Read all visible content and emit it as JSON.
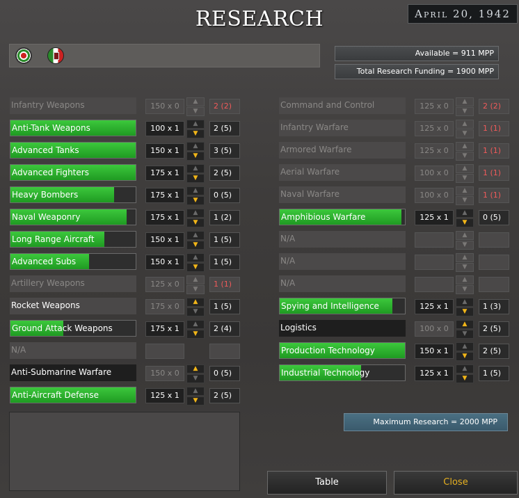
{
  "header": {
    "title": "RESEARCH",
    "date": "April 20, 1942"
  },
  "flags": [
    "roundel-icon",
    "italy-shield-icon"
  ],
  "mpp": {
    "available": "Available = 911 MPP",
    "funding": "Total Research Funding = 1900 MPP"
  },
  "left": [
    {
      "name": "Infantry Weapons",
      "cost": "150 x 0",
      "level": "2 (2)",
      "fill": 0,
      "style": "dim",
      "cost_style": "dim",
      "level_style": "red",
      "up": "faint",
      "down": "faint"
    },
    {
      "name": "Anti-Tank Weapons",
      "cost": "100 x 1",
      "level": "2 (5)",
      "fill": 1.0,
      "style": "green",
      "cost_style": "",
      "level_style": "",
      "up": "off",
      "down": "on"
    },
    {
      "name": "Advanced Tanks",
      "cost": "150 x 1",
      "level": "3 (5)",
      "fill": 1.0,
      "style": "green",
      "cost_style": "",
      "level_style": "",
      "up": "off",
      "down": "on"
    },
    {
      "name": "Advanced Fighters",
      "cost": "175 x 1",
      "level": "2 (5)",
      "fill": 1.0,
      "style": "green",
      "cost_style": "",
      "level_style": "",
      "up": "off",
      "down": "on"
    },
    {
      "name": "Heavy Bombers",
      "cost": "175 x 1",
      "level": "0 (5)",
      "fill": 0.83,
      "style": "green",
      "cost_style": "",
      "level_style": "",
      "up": "off",
      "down": "on"
    },
    {
      "name": "Naval Weaponry",
      "cost": "175 x 1",
      "level": "1 (2)",
      "fill": 0.93,
      "style": "green",
      "cost_style": "",
      "level_style": "",
      "up": "off",
      "down": "on"
    },
    {
      "name": "Long Range Aircraft",
      "cost": "150 x 1",
      "level": "1 (5)",
      "fill": 0.75,
      "style": "green",
      "cost_style": "",
      "level_style": "",
      "up": "off",
      "down": "on"
    },
    {
      "name": "Advanced Subs",
      "cost": "150 x 1",
      "level": "1 (5)",
      "fill": 0.63,
      "style": "green",
      "cost_style": "",
      "level_style": "",
      "up": "off",
      "down": "on"
    },
    {
      "name": "Artillery Weapons",
      "cost": "125 x 0",
      "level": "1 (1)",
      "fill": 0,
      "style": "dim",
      "cost_style": "dim",
      "level_style": "red",
      "up": "faint",
      "down": "faint"
    },
    {
      "name": "Rocket Weapons",
      "cost": "175 x 0",
      "level": "1 (5)",
      "fill": 0,
      "style": "plain",
      "cost_style": "dim",
      "level_style": "",
      "up": "on",
      "down": "off"
    },
    {
      "name": "Ground Attack Weapons",
      "cost": "175 x 1",
      "level": "2 (4)",
      "fill": 0.42,
      "style": "green",
      "cost_style": "",
      "level_style": "",
      "up": "off",
      "down": "on"
    },
    {
      "name": "N/A",
      "cost": "",
      "level": "",
      "fill": 0,
      "style": "dim",
      "cost_style": "empty",
      "level_style": "empty",
      "up": "none",
      "down": "none"
    },
    {
      "name": "Anti-Submarine Warfare",
      "cost": "150 x 0",
      "level": "0 (5)",
      "fill": 0,
      "style": "black",
      "cost_style": "dim",
      "level_style": "",
      "up": "on",
      "down": "off"
    },
    {
      "name": "Anti-Aircraft Defense",
      "cost": "125 x 1",
      "level": "2 (5)",
      "fill": 1.0,
      "style": "green",
      "cost_style": "",
      "level_style": "",
      "up": "off",
      "down": "on"
    }
  ],
  "right": [
    {
      "name": "Command and Control",
      "cost": "125 x 0",
      "level": "2 (2)",
      "fill": 0,
      "style": "dim",
      "cost_style": "dim",
      "level_style": "red",
      "up": "faint",
      "down": "faint"
    },
    {
      "name": "Infantry Warfare",
      "cost": "125 x 0",
      "level": "1 (1)",
      "fill": 0,
      "style": "dim",
      "cost_style": "dim",
      "level_style": "red",
      "up": "faint",
      "down": "faint"
    },
    {
      "name": "Armored Warfare",
      "cost": "125 x 0",
      "level": "1 (1)",
      "fill": 0,
      "style": "dim",
      "cost_style": "dim",
      "level_style": "red",
      "up": "faint",
      "down": "faint"
    },
    {
      "name": "Aerial Warfare",
      "cost": "100 x 0",
      "level": "1 (1)",
      "fill": 0,
      "style": "dim",
      "cost_style": "dim",
      "level_style": "red",
      "up": "faint",
      "down": "faint"
    },
    {
      "name": "Naval Warfare",
      "cost": "100 x 0",
      "level": "1 (1)",
      "fill": 0,
      "style": "dim",
      "cost_style": "dim",
      "level_style": "red",
      "up": "faint",
      "down": "faint"
    },
    {
      "name": "Amphibious Warfare",
      "cost": "125 x 1",
      "level": "0 (5)",
      "fill": 0.97,
      "style": "green",
      "cost_style": "",
      "level_style": "",
      "up": "off",
      "down": "on"
    },
    {
      "name": "N/A",
      "cost": "",
      "level": "",
      "fill": 0,
      "style": "dim",
      "cost_style": "empty",
      "level_style": "empty",
      "up": "faint",
      "down": "faint"
    },
    {
      "name": "N/A",
      "cost": "",
      "level": "",
      "fill": 0,
      "style": "dim",
      "cost_style": "empty",
      "level_style": "empty",
      "up": "faint",
      "down": "faint"
    },
    {
      "name": "N/A",
      "cost": "",
      "level": "",
      "fill": 0,
      "style": "dim",
      "cost_style": "empty",
      "level_style": "empty",
      "up": "faint",
      "down": "faint"
    },
    {
      "name": "Spying and Intelligence",
      "cost": "125 x 1",
      "level": "1 (3)",
      "fill": 0.9,
      "style": "green",
      "cost_style": "",
      "level_style": "",
      "up": "off",
      "down": "on"
    },
    {
      "name": "Logistics",
      "cost": "100 x 0",
      "level": "2 (5)",
      "fill": 0,
      "style": "black",
      "cost_style": "dim",
      "level_style": "",
      "up": "on",
      "down": "off"
    },
    {
      "name": "Production Technology",
      "cost": "150 x 1",
      "level": "2 (5)",
      "fill": 1.0,
      "style": "green",
      "cost_style": "",
      "level_style": "",
      "up": "off",
      "down": "on"
    },
    {
      "name": "Industrial Technology",
      "cost": "125 x 1",
      "level": "1 (5)",
      "fill": 0.65,
      "style": "green",
      "cost_style": "",
      "level_style": "",
      "up": "off",
      "down": "on"
    }
  ],
  "max_research": "Maximum Research =  2000 MPP",
  "buttons": {
    "table": "Table",
    "close": "Close"
  }
}
